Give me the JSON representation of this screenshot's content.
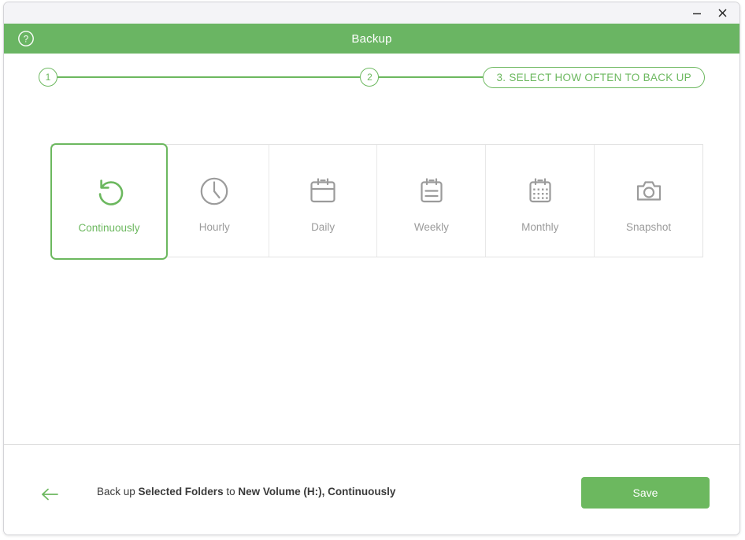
{
  "window": {
    "titlebar": {
      "minimize_label": "−",
      "minimize_icon": "minimize-icon",
      "close_label": "✕",
      "close_icon": "close-icon"
    },
    "header": {
      "title": "Backup",
      "help_icon": "help-circle-icon"
    }
  },
  "stepper": {
    "steps": [
      {
        "number": "1",
        "state": "done"
      },
      {
        "number": "2",
        "state": "done"
      },
      {
        "label": "3. SELECT HOW OFTEN TO BACK UP",
        "state": "current"
      }
    ]
  },
  "options": {
    "selected_index": 0,
    "items": [
      {
        "label": "Continuously",
        "icon": "loop-arrow-icon",
        "selected": true
      },
      {
        "label": "Hourly",
        "icon": "clock-icon",
        "selected": false
      },
      {
        "label": "Daily",
        "icon": "calendar-blank-icon",
        "selected": false
      },
      {
        "label": "Weekly",
        "icon": "calendar-lines-icon",
        "selected": false
      },
      {
        "label": "Monthly",
        "icon": "calendar-grid-icon",
        "selected": false
      },
      {
        "label": "Snapshot",
        "icon": "camera-icon",
        "selected": false
      }
    ]
  },
  "footer": {
    "back_icon": "arrow-left-icon",
    "status": {
      "prefix": "Back up ",
      "source": "Selected Folders",
      "middle": " to ",
      "destination": "New Volume (H:), Continuously"
    },
    "save_label": "Save"
  },
  "colors": {
    "accent_green": "#6cb85f",
    "header_green": "#6ab563",
    "muted_gray": "#9b9b9b",
    "border_gray": "#e3e3e3",
    "titlebar_bg": "#f4f4f7"
  }
}
